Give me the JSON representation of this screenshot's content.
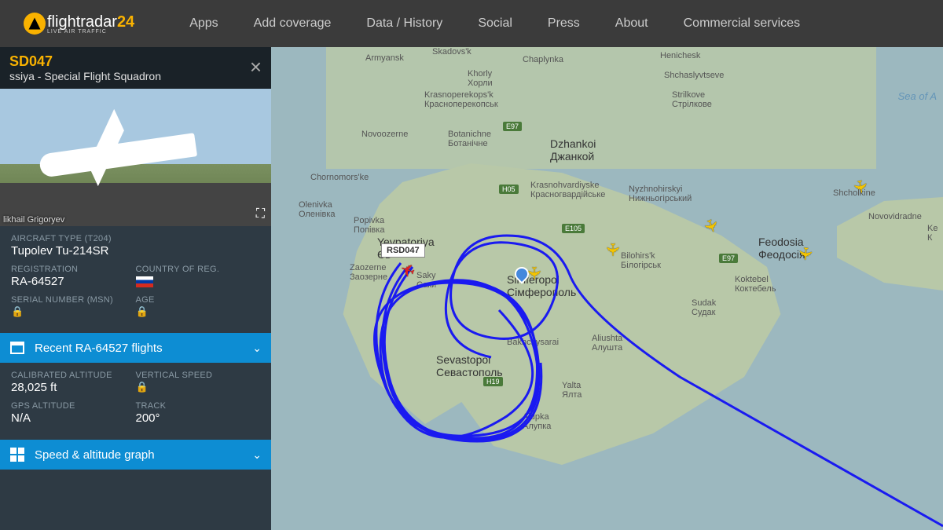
{
  "brand": {
    "name_a": "flightradar",
    "name_b": "24",
    "tagline": "LIVE AIR TRAFFIC"
  },
  "nav": {
    "apps": "Apps",
    "coverage": "Add coverage",
    "data": "Data / History",
    "social": "Social",
    "press": "Press",
    "about": "About",
    "commercial": "Commercial services"
  },
  "flight": {
    "callsign": "SD047",
    "operator": "ssiya - Special Flight Squadron",
    "photo_credit": "likhail Grigoryev",
    "type_label": "AIRCRAFT TYPE   (T204)",
    "type": "Tupolev Tu-214SR",
    "reg_label": "REGISTRATION",
    "reg": "RA-64527",
    "country_label": "COUNTRY OF REG.",
    "msn_label": "SERIAL NUMBER (MSN)",
    "age_label": "AGE",
    "recent": "Recent RA-64527 flights",
    "alt_label": "CALIBRATED ALTITUDE",
    "alt": "28,025 ft",
    "vs_label": "VERTICAL SPEED",
    "gps_label": "GPS ALTITUDE",
    "gps": "N/A",
    "track_label": "TRACK",
    "track": "200°",
    "graph": "Speed & altitude graph"
  },
  "map": {
    "selected_label": "RSD047",
    "sea": "Sea of A",
    "cities": {
      "armyansk": "Armyansk",
      "skadovsk": "Skadovs'k",
      "chaplynka": "Chaplynka",
      "henichesk": "Henichesk",
      "khorly": "Khorly\nХорли",
      "krasnoperekopsk": "Krasnoperekops'k\nКрасноперекопськ",
      "strilkove": "Strilkove\nСтрілкове",
      "shchaslyvtseve": "Shchaslyvtseve",
      "novoozerne": "Novoozerne",
      "botanichne": "Botanichne\nБотанічне",
      "dzhankoi": "Dzhankoi\nДжанкой",
      "chornomorske": "Chornomors'ke",
      "olenivka": "Olenivka\nОленівка",
      "popivka": "Popivka\nПопівка",
      "yevpatoriya": "Yevpatoriya\nЄв",
      "zaozerne": "Zaozerne\nЗаозерне",
      "saky": "Saky\nСаки",
      "krasnohvardiyske": "Krasnohvardiyske\nКрасногвардійське",
      "nyzhnohirskyi": "Nyzhnohirskyi\nНижньогірський",
      "bilohirsk": "Bilohirs'k\nБілогірськ",
      "simferopol": "Simferopol\nСімферополь",
      "sevastopol": "Sevastopol\nСевастополь",
      "bakhchysarai": "Bakhchysarai",
      "alushta": "Aliushta\nАлушта",
      "yalta": "Yalta\nЯлта",
      "alupka": "Alupka\nАлупка",
      "sudak": "Sudak\nСудак",
      "koktebel": "Koktebel\nКоктебель",
      "feodosia": "Feodosia\nФеодосія",
      "shcholkine": "Shcholkine",
      "novovidradne": "Novovidradne",
      "kerch": "Ke\nК"
    },
    "roads": {
      "e97a": "E97",
      "e97b": "E97",
      "e105": "E105",
      "h05": "H05",
      "h19": "H19"
    }
  }
}
